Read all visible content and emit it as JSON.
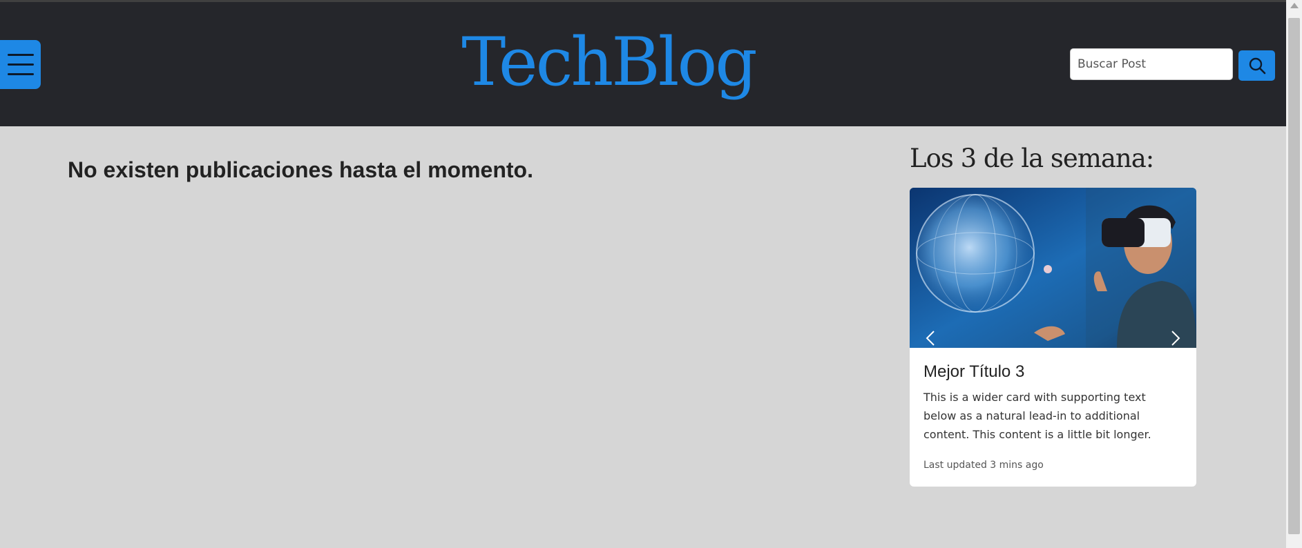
{
  "header": {
    "brand": "TechBlog",
    "search_placeholder": "Buscar Post",
    "menu_icon": "hamburger-icon",
    "search_icon": "search-icon"
  },
  "main": {
    "empty_message": "No existen publicaciones hasta el momento."
  },
  "sidebar": {
    "title": "Los 3 de la semana:",
    "card": {
      "title": "Mejor Título 3",
      "text": "This is a wider card with supporting text below as a natural lead-in to additional content. This content is a little bit longer.",
      "updated": "Last updated 3 mins ago"
    }
  },
  "colors": {
    "accent": "#1e88e5",
    "navbar": "#25262b",
    "background": "#d6d6d6"
  }
}
